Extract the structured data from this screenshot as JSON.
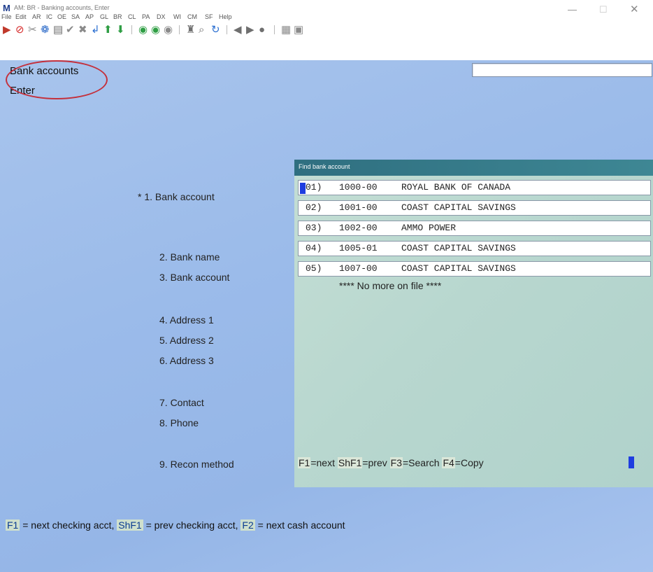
{
  "window": {
    "title": "AM: BR - Banking accounts, Enter",
    "logo": "M",
    "controls": {
      "minimize": "—",
      "maximize": "☐",
      "close": "✕"
    }
  },
  "menu": [
    "File",
    "Edit",
    "AR",
    "IC",
    "OE",
    "SA",
    "AP",
    "GL",
    "BR",
    "CL",
    "PA",
    "DX",
    "WI",
    "CM",
    "SF",
    "Help"
  ],
  "toolbar_icons": [
    {
      "name": "exit-icon",
      "glyph": "▶",
      "color": "#c0392b"
    },
    {
      "name": "cancel-icon",
      "glyph": "⊘",
      "color": "#d62828"
    },
    {
      "name": "tools-icon",
      "glyph": "✂",
      "color": "#8a8a8a"
    },
    {
      "name": "settings-icon",
      "glyph": "❁",
      "color": "#2d6bc9"
    },
    {
      "name": "print-icon",
      "glyph": "▤",
      "color": "#6f6f6f"
    },
    {
      "name": "accept-icon",
      "glyph": "✔",
      "color": "#8a8a8a"
    },
    {
      "name": "delete-icon",
      "glyph": "✖",
      "color": "#8a8a8a"
    },
    {
      "name": "enter-icon",
      "glyph": "↲",
      "color": "#2b6fd1"
    },
    {
      "name": "arrow-up-icon",
      "glyph": "⬆",
      "color": "#2f9e44"
    },
    {
      "name": "arrow-down-icon",
      "glyph": "⬇",
      "color": "#2f9e44"
    },
    {
      "name": "nav-back-icon",
      "glyph": "◉",
      "color": "#2f9e44"
    },
    {
      "name": "nav-forward-icon",
      "glyph": "◉",
      "color": "#2f9e44"
    },
    {
      "name": "stop-icon",
      "glyph": "◉",
      "color": "#8a8a8a"
    },
    {
      "name": "binoculars-icon",
      "glyph": "♜",
      "color": "#6f6f6f"
    },
    {
      "name": "search-icon",
      "glyph": "⌕",
      "color": "#6f6f6f"
    },
    {
      "name": "refresh-icon",
      "glyph": "↻",
      "color": "#2b6fd1"
    },
    {
      "name": "prev-icon",
      "glyph": "◀",
      "color": "#6f6f6f"
    },
    {
      "name": "next-icon",
      "glyph": "▶",
      "color": "#6f6f6f"
    },
    {
      "name": "help-icon",
      "glyph": "●",
      "color": "#6f6f6f"
    },
    {
      "name": "calculator-icon",
      "glyph": "▦",
      "color": "#8a8a8a"
    },
    {
      "name": "notes-icon",
      "glyph": "▣",
      "color": "#8a8a8a"
    }
  ],
  "screen": {
    "title": "Bank accounts",
    "mode": "Enter",
    "top_input_value": ""
  },
  "fields": [
    {
      "label": "* 1. Bank account"
    },
    {
      "label": "2. Bank name"
    },
    {
      "label": "3. Bank account"
    },
    {
      "label": "4. Address 1"
    },
    {
      "label": "5. Address 2"
    },
    {
      "label": "6. Address 3"
    },
    {
      "label": "7. Contact"
    },
    {
      "label": "8. Phone"
    },
    {
      "label": "9. Recon method"
    }
  ],
  "lookup": {
    "title": "Find bank account",
    "rows": [
      {
        "num": "01)",
        "account": "1000-00",
        "name": "ROYAL BANK OF CANADA"
      },
      {
        "num": "02)",
        "account": "1001-00",
        "name": "COAST CAPITAL SAVINGS"
      },
      {
        "num": "03)",
        "account": "1002-00",
        "name": "AMMO POWER"
      },
      {
        "num": "04)",
        "account": "1005-01",
        "name": "COAST CAPITAL SAVINGS"
      },
      {
        "num": "05)",
        "account": "1007-00",
        "name": "COAST CAPITAL SAVINGS"
      }
    ],
    "end_message": "**** No more on file ****",
    "hints": {
      "f1": "F1",
      "f1_text": "=next ",
      "shf1": "ShF1",
      "shf1_text": "=prev ",
      "f3": "F3",
      "f3_text": "=Search ",
      "f4": "F4",
      "f4_text": "=Copy"
    }
  },
  "footer": {
    "f1": "F1",
    "f1_text": " = next checking acct, ",
    "shf1": "ShF1",
    "shf1_text": " = prev checking acct, ",
    "f2": "F2",
    "f2_text": " = next cash account"
  },
  "colors": {
    "background": "#9bbbea",
    "dialog_title": "#2f6f80",
    "cursor": "#1f3de0",
    "annotation_oval": "#c4303c"
  }
}
